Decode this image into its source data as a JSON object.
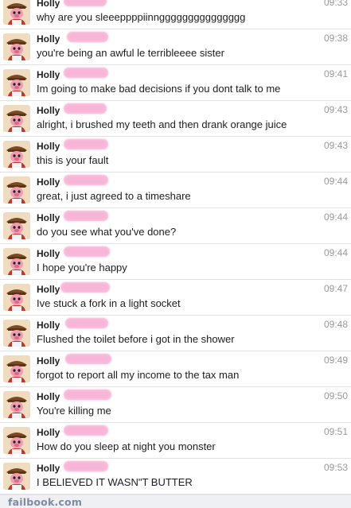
{
  "conversation": {
    "messages": [
      {
        "sender": "Holly",
        "time": "09:33",
        "text": "why are you sleeeppppiinnggggggggggggggg"
      },
      {
        "sender": "Holly",
        "time": "09:38",
        "text": "you're being an awful le terribleeee sister"
      },
      {
        "sender": "Holly",
        "time": "09:41",
        "text": "Im going to make bad decisions if you dont talk to me"
      },
      {
        "sender": "Holly",
        "time": "09:43",
        "text": "alright, i brushed my teeth and then drank orange juice"
      },
      {
        "sender": "Holly",
        "time": "09:43",
        "text": "this is your fault"
      },
      {
        "sender": "Holly",
        "time": "09:44",
        "text": "great, i just agreed to a timeshare"
      },
      {
        "sender": "Holly",
        "time": "09:44",
        "text": "do you see what you've done?"
      },
      {
        "sender": "Holly",
        "time": "09:44",
        "text": "I hope you're happy"
      },
      {
        "sender": "Holly",
        "time": "09:47",
        "text": "Ive stuck a fork in a light socket"
      },
      {
        "sender": "Holly",
        "time": "09:48",
        "text": "Flushed the toilet before i got in the shower"
      },
      {
        "sender": "Holly",
        "time": "09:49",
        "text": "forgot to report all my income to the tax man"
      },
      {
        "sender": "Holly",
        "time": "09:50",
        "text": "You're killing me"
      },
      {
        "sender": "Holly",
        "time": "09:51",
        "text": "How do you sleep at night you monster"
      },
      {
        "sender": "Holly",
        "time": "09:53",
        "text": "I BELIEVED IT WASN\"T BUTTER"
      }
    ]
  },
  "footer": {
    "brand": "failbook.com"
  },
  "colors": {
    "redaction": "#f7b3d6",
    "timestamp": "#9a9a9a",
    "divider": "#e2e2e2"
  },
  "icons": {
    "avatar": "cartoon-avatar-icon"
  }
}
